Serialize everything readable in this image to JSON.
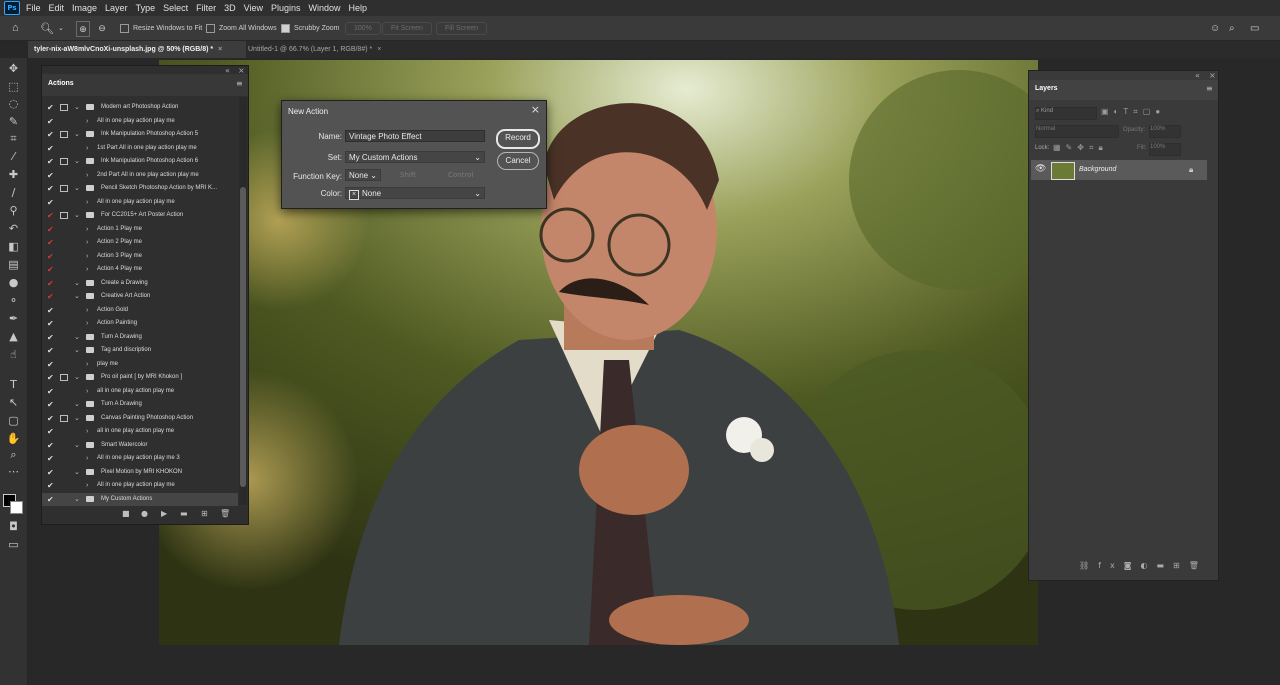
{
  "menu": [
    "File",
    "Edit",
    "Image",
    "Layer",
    "Type",
    "Select",
    "Filter",
    "3D",
    "View",
    "Plugins",
    "Window",
    "Help"
  ],
  "options": {
    "resize_windows": "Resize Windows to Fit",
    "zoom_all": "Zoom All Windows",
    "scrubby_zoom": "Scrubby Zoom",
    "hundred": "100%",
    "fit_screen": "Fit Screen",
    "fill_screen": "Fill Screen"
  },
  "tabs": [
    {
      "label": "tyler-nix-aW8mlvCnoXi-unsplash.jpg @ 50% (RGB/8) *"
    },
    {
      "label": "Untitled-1 @ 66.7% (Layer 1, RGB/8#) *"
    }
  ],
  "actions_panel": {
    "title": "Actions",
    "rows": [
      {
        "label": "Modern art Photoshop Action",
        "type": "set"
      },
      {
        "label": "All in one play action play me",
        "type": "action"
      },
      {
        "label": "Ink Manipulation Photoshop Action 5",
        "type": "set"
      },
      {
        "label": "1st Part All in one play action play me",
        "type": "action"
      },
      {
        "label": "Ink Manipulation Photoshop Action 6",
        "type": "set"
      },
      {
        "label": "2nd Part All in one play action play me",
        "type": "action"
      },
      {
        "label": "Pencil Sketch Photoshop Action by MRI K...",
        "type": "set"
      },
      {
        "label": "All in one play action play me",
        "type": "action"
      },
      {
        "label": "For CC2015+ Art Poster Action",
        "type": "set"
      },
      {
        "label": "Action 1 Play me",
        "type": "action"
      },
      {
        "label": "Action 2 Play me",
        "type": "action"
      },
      {
        "label": "Action 3 Play me",
        "type": "action"
      },
      {
        "label": "Action 4 Play me",
        "type": "action"
      },
      {
        "label": "Create a Drawing",
        "type": "set"
      },
      {
        "label": "Creative Art Action",
        "type": "set"
      },
      {
        "label": "Action Gold",
        "type": "action"
      },
      {
        "label": "Action Painting",
        "type": "action"
      },
      {
        "label": "Turn A Drawing",
        "type": "set"
      },
      {
        "label": "Tag and discription",
        "type": "set"
      },
      {
        "label": "play me",
        "type": "action"
      },
      {
        "label": "Pro oil paint [ by MRI Khokon ]",
        "type": "set"
      },
      {
        "label": "all in one play action play me",
        "type": "action"
      },
      {
        "label": "Turn A Drawing",
        "type": "set"
      },
      {
        "label": "Canvas Painting Photoshop Action",
        "type": "set"
      },
      {
        "label": "all in one play action play me",
        "type": "action"
      },
      {
        "label": "Smart Watercolor",
        "type": "set"
      },
      {
        "label": "All in one play action play me 3",
        "type": "action"
      },
      {
        "label": "Pixel Motion by MRI KHOKON",
        "type": "set"
      },
      {
        "label": "All in one play action play me",
        "type": "action"
      },
      {
        "label": "My Custom Actions",
        "type": "set"
      }
    ],
    "footer_icons": [
      "stop-icon",
      "record-icon",
      "play-icon",
      "new-set-icon",
      "new-action-icon",
      "delete-icon"
    ]
  },
  "layers_panel": {
    "title": "Layers",
    "search_placeholder": "Kind",
    "blend_mode": "Normal",
    "opacity_label": "Opacity:",
    "opacity_value": "100%",
    "lock_label": "Lock:",
    "fill_label": "Fill:",
    "fill_value": "100%",
    "layer_name": "Background"
  },
  "dialog": {
    "title": "New Action",
    "name_label": "Name:",
    "name_value": "Vintage Photo Effect",
    "set_label": "Set:",
    "set_value": "My Custom Actions",
    "fkey_label": "Function Key:",
    "fkey_value": "None",
    "shift_label": "Shift",
    "control_label": "Control",
    "color_label": "Color:",
    "color_value": "None",
    "record_btn": "Record",
    "cancel_btn": "Cancel"
  },
  "colors": {
    "accent": "#31a8ff",
    "panel": "#2f2f2f",
    "dialog": "#535353",
    "red_toggle": "#d23a3a"
  }
}
